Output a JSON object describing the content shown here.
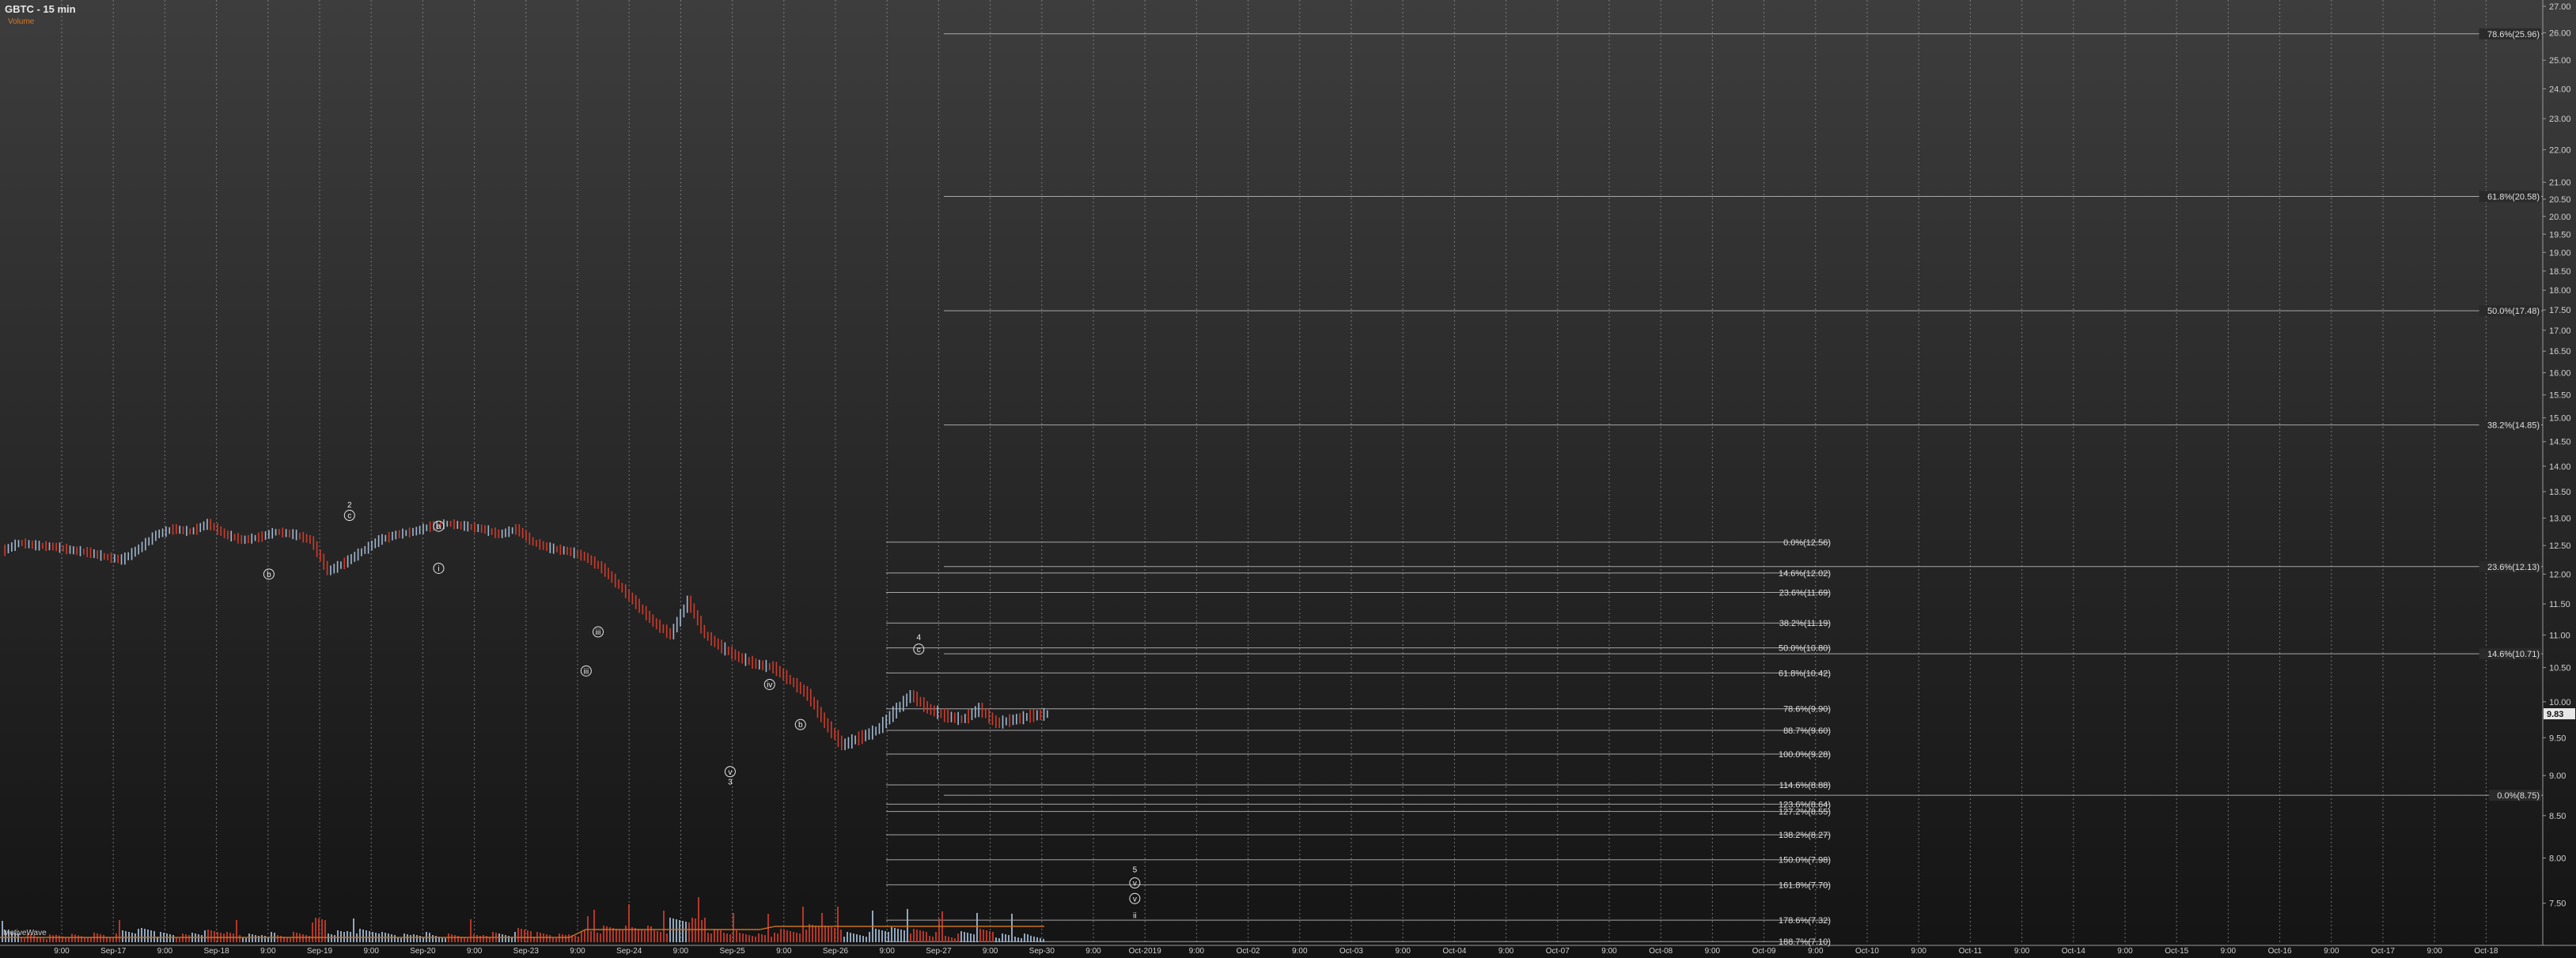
{
  "header": {
    "title": "GBTC - 15 min",
    "subtitle": "Volume"
  },
  "footer": {
    "label": "MotiveWave"
  },
  "chart_data": {
    "type": "line",
    "title": "GBTC - 15 min",
    "ylim": [
      7.0,
      27.0
    ],
    "y_scale": "log",
    "y_ticks": [
      7.5,
      8.0,
      8.5,
      9.0,
      9.5,
      10.0,
      10.5,
      11.0,
      11.5,
      12.0,
      12.5,
      13.0,
      13.5,
      14.0,
      14.5,
      15.0,
      15.5,
      16.0,
      16.5,
      17.0,
      17.5,
      18.0,
      18.5,
      19.0,
      19.5,
      20.0,
      20.5,
      21.0,
      22.0,
      23.0,
      24.0,
      25.0,
      26.0,
      27.0
    ],
    "y_tick_labels": [
      "7.50",
      "8.00",
      "8.50",
      "9.00",
      "9.50",
      "10.00",
      "10.50",
      "11.00",
      "11.50",
      "12.00",
      "12.50",
      "13.00",
      "13.50",
      "14.00",
      "14.50",
      "15.00",
      "15.50",
      "16.00",
      "16.50",
      "17.00",
      "17.50",
      "18.00",
      "18.50",
      "19.00",
      "19.50",
      "20.00",
      "20.50",
      "21.00",
      "22.00",
      "23.00",
      "24.00",
      "25.00",
      "26.00",
      "27.00"
    ],
    "x_ticks": [
      "9:00",
      "Sep-17",
      "9:00",
      "Sep-18",
      "9:00",
      "Sep-19",
      "9:00",
      "Sep-20",
      "9:00",
      "Sep-23",
      "9:00",
      "Sep-24",
      "9:00",
      "Sep-25",
      "9:00",
      "Sep-26",
      "9:00",
      "Sep-27",
      "9:00",
      "Sep-30",
      "9:00",
      "Oct-2019",
      "9:00",
      "Oct-02",
      "9:00",
      "Oct-03",
      "9:00",
      "Oct-04",
      "9:00",
      "Oct-07",
      "9:00",
      "Oct-08",
      "9:00",
      "Oct-09",
      "9:00",
      "Oct-10",
      "9:00",
      "Oct-11",
      "9:00",
      "Oct-14",
      "9:00",
      "Oct-15",
      "9:00",
      "Oct-16",
      "9:00",
      "Oct-17",
      "9:00",
      "Oct-18"
    ],
    "last_price_label": "9.83",
    "price_series": {
      "name": "GBTC",
      "points": [
        [
          0,
          12.4
        ],
        [
          1,
          12.55
        ],
        [
          2,
          12.5
        ],
        [
          3,
          12.48
        ],
        [
          4,
          12.42
        ],
        [
          5,
          12.38
        ],
        [
          6,
          12.3
        ],
        [
          7,
          12.25
        ],
        [
          8,
          12.45
        ],
        [
          9,
          12.7
        ],
        [
          10,
          12.8
        ],
        [
          11,
          12.75
        ],
        [
          12,
          12.9
        ],
        [
          13,
          12.7
        ],
        [
          14,
          12.6
        ],
        [
          15,
          12.65
        ],
        [
          16,
          12.75
        ],
        [
          17,
          12.7
        ],
        [
          18,
          12.6
        ],
        [
          19,
          12.05
        ],
        [
          20,
          12.2
        ],
        [
          21,
          12.4
        ],
        [
          22,
          12.6
        ],
        [
          23,
          12.7
        ],
        [
          24,
          12.75
        ],
        [
          25,
          12.85
        ],
        [
          26,
          12.9
        ],
        [
          27,
          12.85
        ],
        [
          28,
          12.8
        ],
        [
          29,
          12.7
        ],
        [
          30,
          12.8
        ],
        [
          31,
          12.55
        ],
        [
          32,
          12.45
        ],
        [
          33,
          12.4
        ],
        [
          34,
          12.3
        ],
        [
          35,
          12.1
        ],
        [
          36,
          11.8
        ],
        [
          37,
          11.5
        ],
        [
          38,
          11.2
        ],
        [
          39,
          11.0
        ],
        [
          40,
          11.55
        ],
        [
          41,
          11.0
        ],
        [
          42,
          10.8
        ],
        [
          43,
          10.65
        ],
        [
          44,
          10.55
        ],
        [
          45,
          10.5
        ],
        [
          46,
          10.3
        ],
        [
          47,
          10.1
        ],
        [
          48,
          9.7
        ],
        [
          49,
          9.4
        ],
        [
          50,
          9.5
        ],
        [
          51,
          9.6
        ],
        [
          52,
          9.85
        ],
        [
          53,
          10.1
        ],
        [
          54,
          9.9
        ],
        [
          55,
          9.8
        ],
        [
          56,
          9.75
        ],
        [
          57,
          9.9
        ],
        [
          58,
          9.7
        ],
        [
          59,
          9.75
        ],
        [
          60,
          9.8
        ],
        [
          61,
          9.83
        ]
      ]
    },
    "wave_labels": [
      {
        "text": "2",
        "price": 13.25,
        "t": 20.2
      },
      {
        "text": "c",
        "price": 13.05,
        "t": 20.2
      },
      {
        "text": "b",
        "price": 12.0,
        "t": 15.5
      },
      {
        "text": "a",
        "price": 12.85,
        "t": 25.4
      },
      {
        "text": "i",
        "price": 12.1,
        "t": 25.4
      },
      {
        "text": "iii",
        "price": 11.05,
        "t": 34.7
      },
      {
        "text": "iii",
        "price": 10.45,
        "t": 34.0
      },
      {
        "text": "iv",
        "price": 10.25,
        "t": 44.7
      },
      {
        "text": "b",
        "price": 9.68,
        "t": 46.5
      },
      {
        "text": "v",
        "price": 9.05,
        "t": 42.4
      },
      {
        "text": "3",
        "price": 8.92,
        "t": 42.4
      },
      {
        "text": "4",
        "price": 10.97,
        "t": 53.4
      },
      {
        "text": "c",
        "price": 10.78,
        "t": 53.4
      },
      {
        "text": "5",
        "price": 7.87,
        "t": 66.0
      },
      {
        "text": "v",
        "price": 7.72,
        "t": 66.0
      },
      {
        "text": "v",
        "price": 7.55,
        "t": 66.0
      },
      {
        "text": "ii",
        "price": 7.37,
        "t": 66.0
      }
    ],
    "target_boxes": [
      {
        "t0": 54.0,
        "t1": 61.2,
        "price_top": 10.85,
        "price_bottom": 10.42,
        "color": "#141c8c"
      },
      {
        "t0": 62.2,
        "t1": 69.7,
        "price_top": 8.62,
        "price_bottom": 8.22,
        "color": "#141c8c"
      }
    ],
    "fib_set_long": [
      {
        "label": "78.6%(25.96)",
        "price": 25.96
      },
      {
        "label": "61.8%(20.58)",
        "price": 20.58
      },
      {
        "label": "50.0%(17.48)",
        "price": 17.48
      },
      {
        "label": "38.2%(14.85)",
        "price": 14.85
      },
      {
        "label": "23.6%(12.13)",
        "price": 12.13
      },
      {
        "label": "14.6%(10.71)",
        "price": 10.71
      },
      {
        "label": "0.0%(8.75)",
        "price": 8.75
      }
    ],
    "fib_set_short": [
      {
        "label": "0.0%(12.56)",
        "price": 12.56
      },
      {
        "label": "14.6%(12.02)",
        "price": 12.02
      },
      {
        "label": "23.6%(11.69)",
        "price": 11.69
      },
      {
        "label": "38.2%(11.19)",
        "price": 11.19
      },
      {
        "label": "50.0%(10.80)",
        "price": 10.8
      },
      {
        "label": "61.8%(10.42)",
        "price": 10.42
      },
      {
        "label": "78.6%(9.90)",
        "price": 9.9
      },
      {
        "label": "88.7%(9.60)",
        "price": 9.6
      },
      {
        "label": "100.0%(9.28)",
        "price": 9.28
      },
      {
        "label": "114.6%(8.88)",
        "price": 8.88
      },
      {
        "label": "123.6%(8.64)",
        "price": 8.64
      },
      {
        "label": "127.2%(8.55)",
        "price": 8.55
      },
      {
        "label": "138.2%(8.27)",
        "price": 8.27
      },
      {
        "label": "150.0%(7.98)",
        "price": 7.98
      },
      {
        "label": "161.8%(7.70)",
        "price": 7.7
      },
      {
        "label": "178.6%(7.32)",
        "price": 7.32
      },
      {
        "label": "188.7%(7.10)",
        "price": 7.1
      }
    ],
    "colors": {
      "up_bar": "#9fb7d0",
      "down_bar": "#d03a2a",
      "volume_up": "#9fb7d0",
      "volume_down": "#c83a2a",
      "volume_ma": "#c8701e",
      "fib_line": "#bdbdbd",
      "grid": "#8a8a8a",
      "target_box": "#141c8c",
      "price_tag_bg": "#e8e8e8"
    }
  }
}
